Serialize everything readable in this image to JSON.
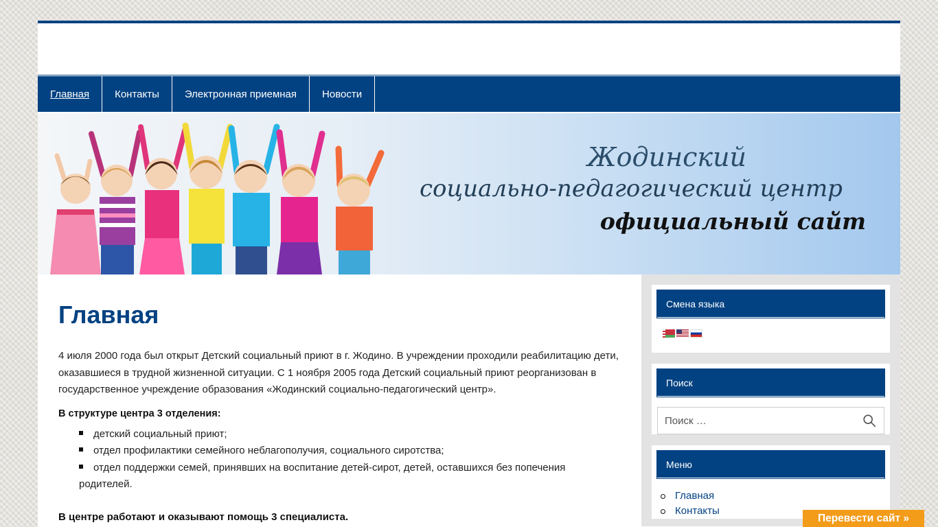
{
  "nav": {
    "items": [
      "Главная",
      "Контакты",
      "Электронная приемная",
      "Новости"
    ]
  },
  "banner": {
    "line1": "Жодинский",
    "line2": "социально-педагогический центр",
    "line3": "официальный сайт"
  },
  "main": {
    "title": "Главная",
    "intro": "4 июля 2000 года был открыт Детский социальный приют в г. Жодино. В учреждении проходили реабилитацию дети, оказавшиеся в трудной жизненной ситуации. С 1 ноября 2005 года Детский социальный приют реорганизован в государственное учреждение образования «Жодинский социально-педагогический центр».",
    "structure_heading": "В структуре центра 3 отделения:",
    "departments": [
      "детский социальный приют;",
      "отдел профилактики семейного неблагополучия, социального сиротства;",
      "отдел поддержки семей, принявших на воспитание детей-сирот, детей, оставшихся без попечения родителей."
    ],
    "specialists_heading": "В центре работают и оказывают помощь 3 специалиста."
  },
  "sidebar": {
    "language_title": "Смена языка",
    "flags": [
      "belarus-flag-icon",
      "usa-flag-icon",
      "russia-flag-icon"
    ],
    "search_title": "Поиск",
    "search_placeholder": "Поиск …",
    "menu_title": "Меню",
    "menu_items": [
      "Главная",
      "Контакты"
    ]
  },
  "translate_button": "Перевести сайт »",
  "colors": {
    "brand": "#024282",
    "accent": "#f39c1a"
  }
}
